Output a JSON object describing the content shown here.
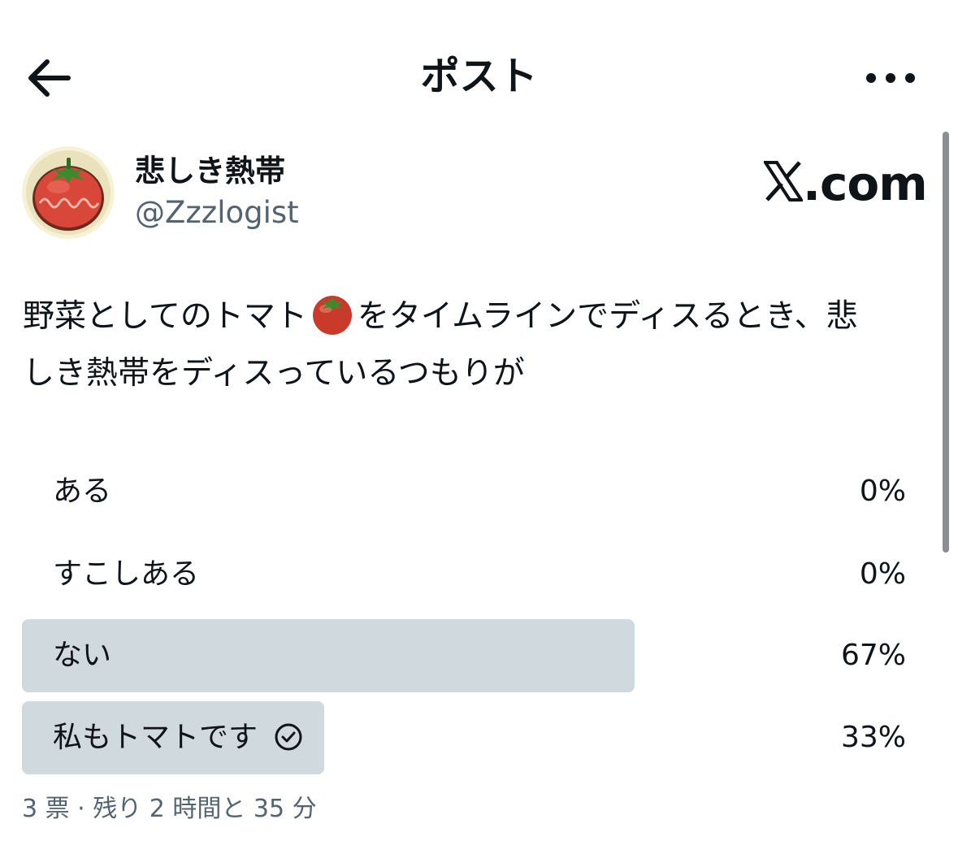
{
  "header": {
    "title": "ポスト",
    "back_icon": "arrow-left-icon",
    "more_icon": "more-horizontal-icon"
  },
  "author": {
    "name": "悲しき熱帯",
    "handle": "@Zzzlogist",
    "avatar_icon": "tomato-avatar"
  },
  "watermark": {
    "text": ".com",
    "logo_icon": "x-logo-icon"
  },
  "post": {
    "line1_before": "野菜としてのトマト",
    "line1_after": "をタイムラインでディスるとき、悲",
    "line2": "しき熱帯をディスっているつもりが",
    "emoji": "tomato-emoji"
  },
  "poll": {
    "options": [
      {
        "label": "ある",
        "percent_text": "0%",
        "percent": 0,
        "selected": false
      },
      {
        "label": "すこしある",
        "percent_text": "0%",
        "percent": 0,
        "selected": false
      },
      {
        "label": "ない",
        "percent_text": "67%",
        "percent": 67,
        "selected": false
      },
      {
        "label": "私もトマトです",
        "percent_text": "33%",
        "percent": 33,
        "selected": true
      }
    ],
    "meta": "3 票 · 残り 2 時間と 35 分",
    "bar_color": "#cfd9de"
  },
  "colors": {
    "text_primary": "#0f1419",
    "text_secondary": "#536471"
  }
}
